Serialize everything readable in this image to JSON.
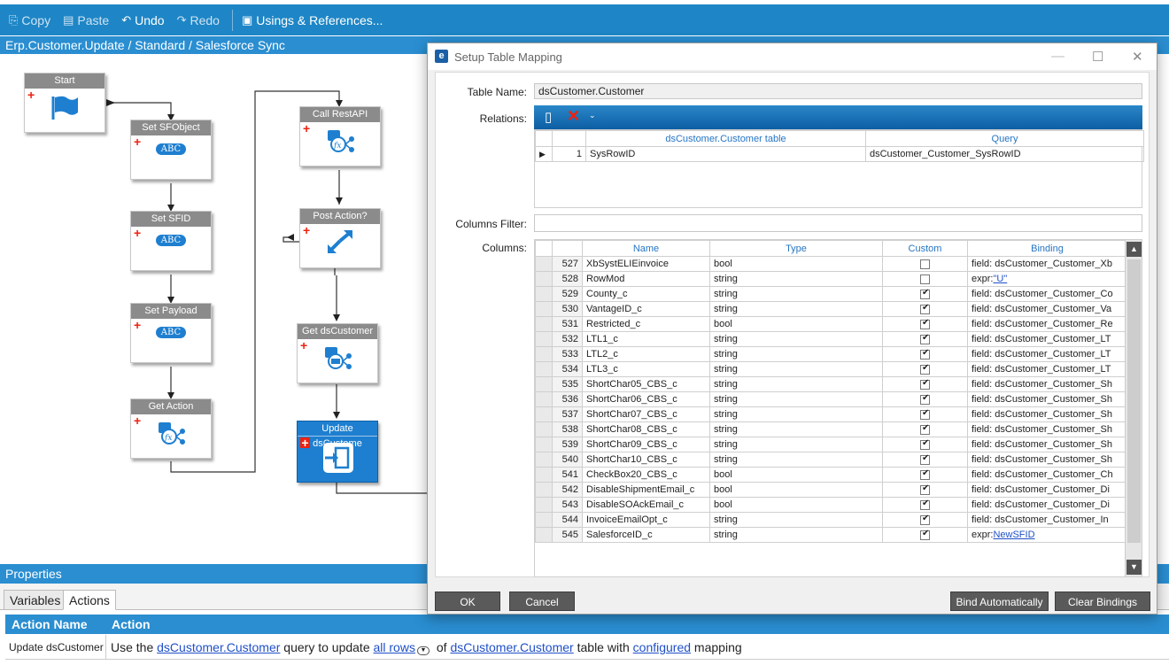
{
  "toolbar": {
    "copy": "Copy",
    "paste": "Paste",
    "undo": "Undo",
    "redo": "Redo",
    "usings": "Usings & References..."
  },
  "breadcrumb": "Erp.Customer.Update / Standard / Salesforce Sync",
  "workflow": {
    "start": "Start",
    "set_sfobject": "Set SFObject",
    "set_sfid": "Set SFID",
    "set_payload": "Set Payload",
    "get_action": "Get Action",
    "call_restapi": "Call RestAPI",
    "post_action": "Post Action?",
    "get_dscustomer": "Get dsCustomer",
    "update_dscustomer": "Update dsCustome",
    "abc_badge": "ABC"
  },
  "properties": {
    "title": "Properties",
    "tabs": [
      "Variables",
      "Actions"
    ],
    "active_tab": "Actions",
    "headers": [
      "Action Name",
      "Action"
    ],
    "row": {
      "name": "Update dsCustomer",
      "t1": "Use the ",
      "l1": "dsCustomer.Customer",
      "t2": " query to update ",
      "l2": "all rows",
      "t3": " of ",
      "l3": "dsCustomer.Customer",
      "t4": " table with ",
      "l4": "configured",
      "t5": " mapping"
    }
  },
  "dialog": {
    "title": "Setup Table Mapping",
    "logo": "e",
    "table_name_label": "Table Name:",
    "table_name_value": "dsCustomer.Customer",
    "relations_label": "Relations:",
    "relations_headers": [
      "dsCustomer.Customer table",
      "Query"
    ],
    "relations_rows": [
      {
        "num": "1",
        "field": "SysRowID",
        "query": "dsCustomer_Customer_SysRowID"
      }
    ],
    "columns_filter_label": "Columns Filter:",
    "columns_filter_value": "",
    "columns_label": "Columns:",
    "columns_headers": [
      "Name",
      "Type",
      "Custom",
      "Binding"
    ],
    "columns_rows": [
      {
        "num": "527",
        "name": "XbSystELIEinvoice",
        "type": "bool",
        "custom": false,
        "binding": "field: dsCustomer_Customer_Xb",
        "link": ""
      },
      {
        "num": "528",
        "name": "RowMod",
        "type": "string",
        "custom": false,
        "binding": "expr:",
        "link": "\"U\""
      },
      {
        "num": "529",
        "name": "County_c",
        "type": "string",
        "custom": true,
        "binding": "field: dsCustomer_Customer_Co",
        "link": ""
      },
      {
        "num": "530",
        "name": "VantageID_c",
        "type": "string",
        "custom": true,
        "binding": "field: dsCustomer_Customer_Va",
        "link": ""
      },
      {
        "num": "531",
        "name": "Restricted_c",
        "type": "bool",
        "custom": true,
        "binding": "field: dsCustomer_Customer_Re",
        "link": ""
      },
      {
        "num": "532",
        "name": "LTL1_c",
        "type": "string",
        "custom": true,
        "binding": "field: dsCustomer_Customer_LT",
        "link": ""
      },
      {
        "num": "533",
        "name": "LTL2_c",
        "type": "string",
        "custom": true,
        "binding": "field: dsCustomer_Customer_LT",
        "link": ""
      },
      {
        "num": "534",
        "name": "LTL3_c",
        "type": "string",
        "custom": true,
        "binding": "field: dsCustomer_Customer_LT",
        "link": ""
      },
      {
        "num": "535",
        "name": "ShortChar05_CBS_c",
        "type": "string",
        "custom": true,
        "binding": "field: dsCustomer_Customer_Sh",
        "link": ""
      },
      {
        "num": "536",
        "name": "ShortChar06_CBS_c",
        "type": "string",
        "custom": true,
        "binding": "field: dsCustomer_Customer_Sh",
        "link": ""
      },
      {
        "num": "537",
        "name": "ShortChar07_CBS_c",
        "type": "string",
        "custom": true,
        "binding": "field: dsCustomer_Customer_Sh",
        "link": ""
      },
      {
        "num": "538",
        "name": "ShortChar08_CBS_c",
        "type": "string",
        "custom": true,
        "binding": "field: dsCustomer_Customer_Sh",
        "link": ""
      },
      {
        "num": "539",
        "name": "ShortChar09_CBS_c",
        "type": "string",
        "custom": true,
        "binding": "field: dsCustomer_Customer_Sh",
        "link": ""
      },
      {
        "num": "540",
        "name": "ShortChar10_CBS_c",
        "type": "string",
        "custom": true,
        "binding": "field: dsCustomer_Customer_Sh",
        "link": ""
      },
      {
        "num": "541",
        "name": "CheckBox20_CBS_c",
        "type": "bool",
        "custom": true,
        "binding": "field: dsCustomer_Customer_Ch",
        "link": ""
      },
      {
        "num": "542",
        "name": "DisableShipmentEmail_c",
        "type": "bool",
        "custom": true,
        "binding": "field: dsCustomer_Customer_Di",
        "link": ""
      },
      {
        "num": "543",
        "name": "DisableSOAckEmail_c",
        "type": "bool",
        "custom": true,
        "binding": "field: dsCustomer_Customer_Di",
        "link": ""
      },
      {
        "num": "544",
        "name": "InvoiceEmailOpt_c",
        "type": "string",
        "custom": true,
        "binding": "field: dsCustomer_Customer_In",
        "link": ""
      },
      {
        "num": "545",
        "name": "SalesforceID_c",
        "type": "string",
        "custom": true,
        "binding": "expr:",
        "link": "NewSFID"
      }
    ],
    "buttons": {
      "ok": "OK",
      "cancel": "Cancel",
      "bind_auto": "Bind Automatically",
      "clear": "Clear Bindings"
    }
  }
}
